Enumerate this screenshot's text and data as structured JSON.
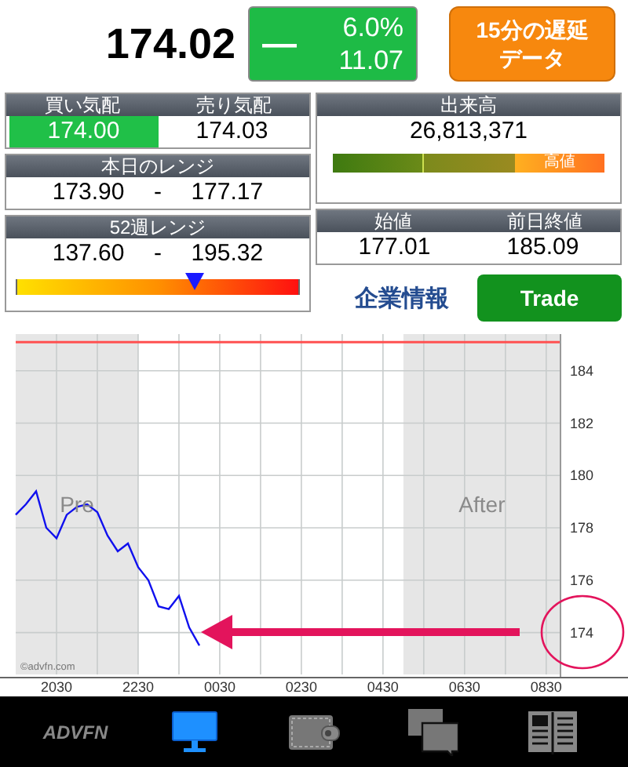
{
  "quote": {
    "price": "174.02",
    "change_sign": "—",
    "change_percent": "6.0%",
    "change": "11.07",
    "delay_button": "15分の遅延データ"
  },
  "bid_ask": {
    "headers": [
      "買い気配",
      "売り気配"
    ],
    "cells": [
      {
        "value": "174.00",
        "selected": true
      },
      {
        "value": "174.03",
        "selected": false
      }
    ]
  },
  "day_range": {
    "title": "本日のレンジ",
    "low": "173.90",
    "separator": "-",
    "high": "177.17"
  },
  "week52_range": {
    "title": "52週レンジ",
    "low": "137.60",
    "separator": "-",
    "high": "195.32",
    "level": 0.63
  },
  "volume": {
    "title": "出来高",
    "value": "26,813,371",
    "meter_label": "高値"
  },
  "open_close": {
    "headers": [
      "始値",
      "前日終値"
    ],
    "values": [
      "177.01",
      "185.09"
    ]
  },
  "company_link": "企業情報",
  "trade_button": "Trade",
  "chart": {
    "credit": "©advfn.com",
    "sessions": [
      {
        "label": "Pre"
      },
      {
        "label": "After"
      }
    ],
    "chart_data": {
      "type": "line",
      "grid": true,
      "ylim": [
        172.4,
        185.4
      ],
      "categories": [
        null,
        null,
        null,
        null,
        "2030",
        null,
        null,
        null,
        null,
        null,
        null,
        null,
        "2230",
        null,
        null,
        null,
        null,
        null,
        null,
        null,
        "0030",
        null,
        null,
        null,
        null,
        null,
        null,
        null,
        "0230",
        null,
        null,
        null,
        null,
        null,
        null,
        null,
        "0430",
        null,
        null,
        null,
        null,
        null,
        null,
        null,
        "0630",
        null,
        null,
        null,
        null,
        null,
        null,
        null,
        "0830",
        null
      ],
      "yticks": [
        174,
        176,
        178,
        180,
        182,
        184
      ],
      "series": [
        {
          "color": "#1010ee",
          "values": [
            178.5,
            178.9,
            179.4,
            178.0,
            177.6,
            178.5,
            178.8,
            178.9,
            178.6,
            177.7,
            177.1,
            177.4,
            176.5,
            176.0,
            175.0,
            174.9,
            175.4,
            174.2,
            173.5,
            null,
            null,
            null,
            null,
            null,
            null,
            null,
            null,
            null,
            null,
            null,
            null,
            null,
            null,
            null,
            null,
            null,
            null,
            null,
            null,
            null,
            null,
            null,
            null,
            null,
            null,
            null,
            null,
            null,
            null,
            null,
            null,
            null,
            null,
            null
          ]
        }
      ],
      "ref_lines": [
        {
          "axis": "y",
          "value": 185.09
        }
      ]
    }
  },
  "tab_bar": [
    {
      "kind": "logo",
      "label": "ADVFN",
      "selected": false
    },
    {
      "kind": "monitor",
      "selected": true
    },
    {
      "kind": "wallet",
      "selected": false
    },
    {
      "kind": "chat",
      "selected": false
    },
    {
      "kind": "news",
      "selected": false
    }
  ]
}
